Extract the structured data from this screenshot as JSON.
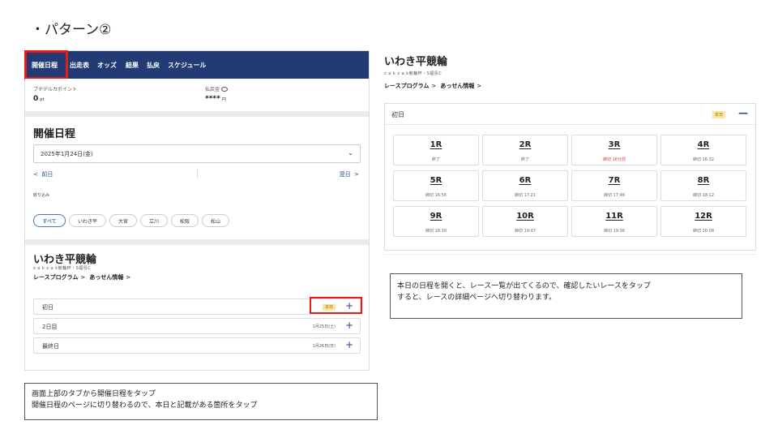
{
  "heading": "・パターン②",
  "tabs": [
    {
      "label": "開催日程"
    },
    {
      "label": "出走表"
    },
    {
      "label": "オッズ"
    },
    {
      "label": "結果"
    },
    {
      "label": "払戻"
    },
    {
      "label": "スケジュール"
    }
  ],
  "points": {
    "label": "プチデルカポイント",
    "value": "0",
    "unit": "pt",
    "refund_label": "払戻金",
    "refund_value": "****",
    "refund_unit": "円"
  },
  "schedule": {
    "title": "開催日程",
    "date": "2025年1月24日(金)",
    "prev": "前日",
    "next": "翌日",
    "filter_label": "絞り込み",
    "chips": [
      "すべて",
      "いわき平",
      "大宮",
      "立川",
      "松阪",
      "松山"
    ]
  },
  "venue": {
    "name": "いわき平競輪",
    "sub": "z a k z a k競輪杯・S福島C",
    "program_link": "レースプログラム",
    "mediation_link": "あっせん情報",
    "today_badge": "本日",
    "days": [
      {
        "label": "初日",
        "date": ""
      },
      {
        "label": "2日目",
        "date": "1月25日(土)"
      },
      {
        "label": "最終日",
        "date": "1月26日(日)"
      }
    ]
  },
  "note_left": {
    "line1": "画面上部のタブから開催日程をタップ",
    "line2": "開催日程のページに切り替わるので、本日と記載がある箇所をタップ"
  },
  "right": {
    "day_label": "初日",
    "races": [
      {
        "num": "1R",
        "status": "終了",
        "soon": false
      },
      {
        "num": "2R",
        "status": "終了",
        "soon": false
      },
      {
        "num": "3R",
        "status": "締切 16分前",
        "soon": true
      },
      {
        "num": "4R",
        "status": "締切 16:32",
        "soon": false
      },
      {
        "num": "5R",
        "status": "締切 16:56",
        "soon": false
      },
      {
        "num": "6R",
        "status": "締切 17:21",
        "soon": false
      },
      {
        "num": "7R",
        "status": "締切 17:46",
        "soon": false
      },
      {
        "num": "8R",
        "status": "締切 18:12",
        "soon": false
      },
      {
        "num": "9R",
        "status": "締切 18:39",
        "soon": false
      },
      {
        "num": "10R",
        "status": "締切 19:07",
        "soon": false
      },
      {
        "num": "11R",
        "status": "締切 19:36",
        "soon": false
      },
      {
        "num": "12R",
        "status": "締切 20:08",
        "soon": false
      }
    ]
  },
  "note_right": {
    "line1": "本日の日程を開くと、レース一覧が出てくるので、確認したいレースをタップ",
    "line2": "すると、レースの詳細ページへ切り替わります。"
  },
  "colors": {
    "tabbar": "#223b74",
    "highlight": "#e31c1c",
    "accent": "#3e78d6",
    "today_badge_bg": "#fae6a0"
  }
}
